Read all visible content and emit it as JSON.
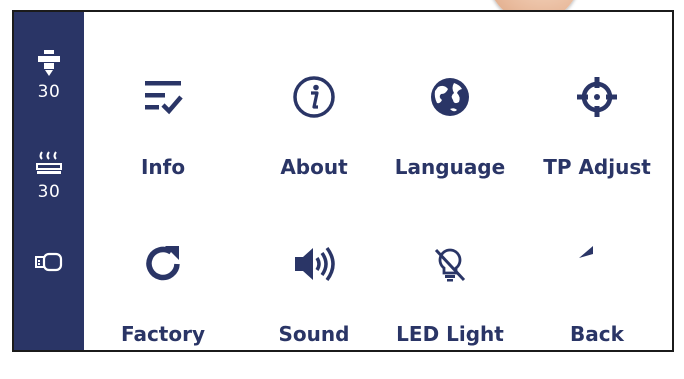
{
  "colors": {
    "sidebar": "#2a3566",
    "accent": "#2a3566",
    "background": "#ffffff"
  },
  "sidebar": {
    "nozzle": {
      "icon": "nozzle-icon",
      "value": "30"
    },
    "bed": {
      "icon": "heated-bed-icon",
      "value": "30"
    },
    "usb": {
      "icon": "usb-drive-icon"
    }
  },
  "menu": {
    "items": [
      {
        "label": "Info",
        "icon": "checklist-icon"
      },
      {
        "label": "About",
        "icon": "info-icon"
      },
      {
        "label": "Language",
        "icon": "globe-icon"
      },
      {
        "label": "TP Adjust",
        "icon": "crosshair-icon"
      },
      {
        "label": "Factory",
        "icon": "reset-icon"
      },
      {
        "label": "Sound",
        "icon": "speaker-icon"
      },
      {
        "label": "LED Light",
        "icon": "bulb-off-icon"
      },
      {
        "label": "Back",
        "icon": "back-arrow-icon"
      }
    ]
  }
}
